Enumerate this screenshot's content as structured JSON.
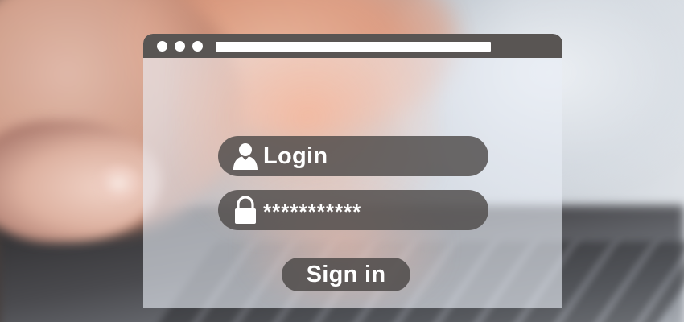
{
  "form": {
    "login_label": "Login",
    "password_value": "***********",
    "signin_label": "Sign in"
  },
  "icons": {
    "login_field": "user-icon",
    "password_field": "lock-icon"
  },
  "colors": {
    "titlebar": "#595553",
    "pill": "#4e4a49",
    "text": "#ffffff"
  }
}
